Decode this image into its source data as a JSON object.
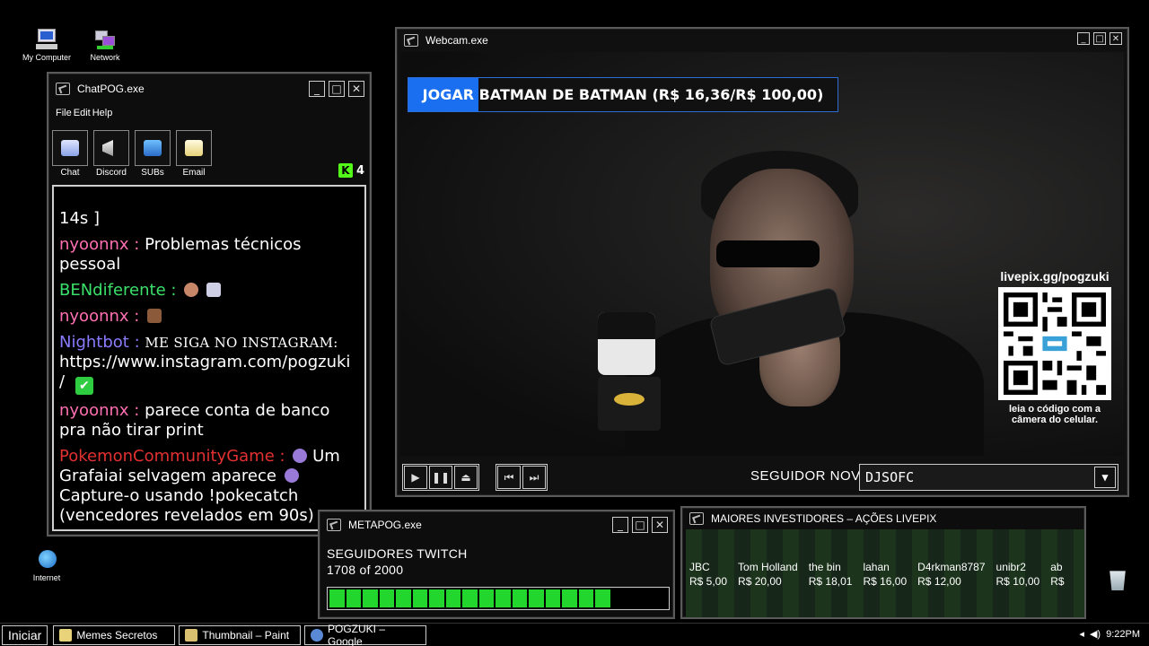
{
  "desktop": {
    "icons": [
      {
        "label": "My Computer"
      },
      {
        "label": "Network"
      },
      {
        "label": "Internet"
      }
    ]
  },
  "chat_window": {
    "title": "ChatPOG.exe",
    "menu": [
      "File",
      "Edit",
      "Help"
    ],
    "tools": [
      {
        "label": "Chat"
      },
      {
        "label": "Discord"
      },
      {
        "label": "SUBs"
      },
      {
        "label": "Email"
      }
    ],
    "kick_count": "4",
    "messages": [
      {
        "user": "",
        "text": "14s ]",
        "color": "#ffffff"
      },
      {
        "user": "nyoonnx :",
        "text": "Problemas técnicos pessoal",
        "color": "#ff6fb1"
      },
      {
        "user": "BENdiferente :",
        "text": "",
        "color": "#3be06a"
      },
      {
        "user": "nyoonnx :",
        "text": "",
        "color": "#ff6fb1"
      },
      {
        "user": "Nightbot :",
        "text": "me siga no instagram:",
        "link": "https://www.instagram.com/pogzuki",
        "after": "/",
        "color": "#8a7cff"
      },
      {
        "user": "nyoonnx :",
        "text": "parece conta de banco pra não tirar print",
        "color": "#ff6fb1"
      },
      {
        "user": "PokemonCommunityGame :",
        "text": "Um Grafaiai selvagem aparece",
        "text2": "Capture-o usando !pokecatch (vencedores revelados em 90s)",
        "color": "#e33030"
      }
    ]
  },
  "webcam_window": {
    "title": "Webcam.exe",
    "goal_text": "JOGAR BATMAN DE BATMAN (R$ 16,36/R$ 100,00)",
    "goal_current": 16.36,
    "goal_target": 100.0,
    "qr_url": "livepix.gg/pogzuki",
    "qr_caption": "leia o código com a câmera do celular.",
    "follow_label": "SEGUIDOR NOVO",
    "follow_value": "DJSOFC"
  },
  "meta_window": {
    "title": "METAPOG.exe",
    "label": "SEGUIDORES TWITCH",
    "progress_text": "1708 of 2000",
    "current": 1708,
    "target": 2000
  },
  "investors_window": {
    "title": "MAIORES INVESTIDORES – AÇÕES LIVEPIX",
    "investors": [
      {
        "name": "JBC",
        "amount": "R$ 5,00"
      },
      {
        "name": "Tom Holland",
        "amount": "R$ 20,00"
      },
      {
        "name": "the bin",
        "amount": "R$ 18,01"
      },
      {
        "name": "lahan",
        "amount": "R$ 16,00"
      },
      {
        "name": "D4rkman8787",
        "amount": "R$ 12,00"
      },
      {
        "name": "unibr2",
        "amount": "R$ 10,00"
      },
      {
        "name": "ab",
        "amount": "R$"
      }
    ]
  },
  "taskbar": {
    "start": "Iniciar",
    "tasks": [
      {
        "label": "Memes Secretos",
        "icon_color": "#e8d27a"
      },
      {
        "label": "Thumbnail – Paint",
        "icon_color": "#d8c070"
      },
      {
        "label": "POGZUKI – Google",
        "icon_color": "#5a8ad6"
      }
    ],
    "clock": "9:22PM"
  },
  "colors": {
    "goal_fill": "#1a6ef0",
    "progress_green": "#22d62e",
    "kick_green": "#53fc18"
  }
}
